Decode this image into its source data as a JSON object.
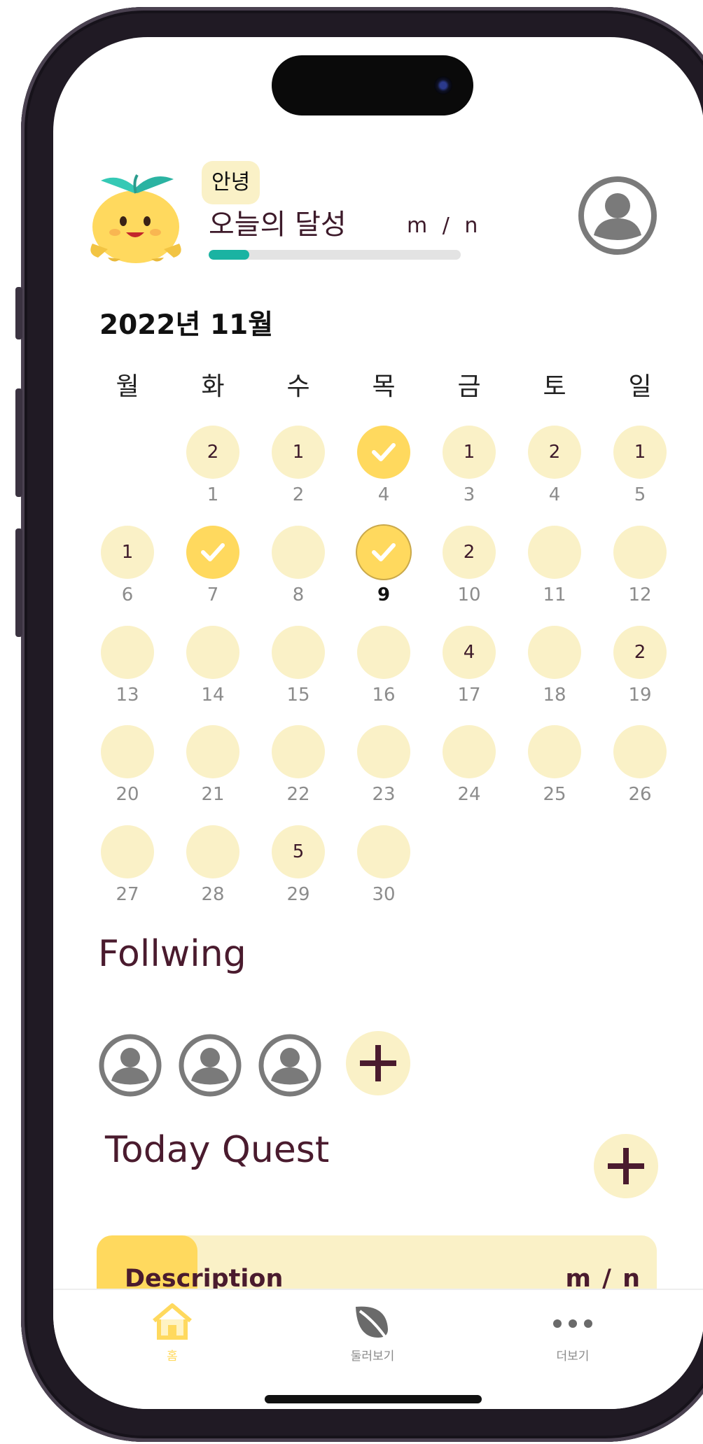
{
  "header": {
    "greeting": "안녕",
    "achievement_label": "오늘의 달성",
    "achievement_ratio": "m / n",
    "achievement_progress": 0.16
  },
  "calendar": {
    "month_title": "2022년 11월",
    "weekdays": [
      "월",
      "화",
      "수",
      "목",
      "금",
      "토",
      "일"
    ],
    "today": "9",
    "weeks": [
      [
        null,
        {
          "day": "1",
          "count": "2"
        },
        {
          "day": "2",
          "count": "1"
        },
        {
          "day": "4",
          "done": true
        },
        {
          "day": "3",
          "count": "1"
        },
        {
          "day": "4",
          "count": "2"
        },
        {
          "day": "5",
          "count": "1"
        }
      ],
      [
        {
          "day": "6",
          "count": "1"
        },
        {
          "day": "7",
          "done": true
        },
        {
          "day": "8"
        },
        {
          "day": "9",
          "done": true,
          "today": true
        },
        {
          "day": "10",
          "count": "2"
        },
        {
          "day": "11"
        },
        {
          "day": "12"
        }
      ],
      [
        {
          "day": "13"
        },
        {
          "day": "14"
        },
        {
          "day": "15"
        },
        {
          "day": "16"
        },
        {
          "day": "17",
          "count": "4"
        },
        {
          "day": "18"
        },
        {
          "day": "19",
          "count": "2"
        }
      ],
      [
        {
          "day": "20"
        },
        {
          "day": "21"
        },
        {
          "day": "22"
        },
        {
          "day": "23"
        },
        {
          "day": "24"
        },
        {
          "day": "25"
        },
        {
          "day": "26"
        }
      ],
      [
        {
          "day": "27"
        },
        {
          "day": "28"
        },
        {
          "day": "29",
          "count": "5"
        },
        {
          "day": "30"
        },
        null,
        null,
        null
      ]
    ]
  },
  "following": {
    "title": "Follwing",
    "avatar_count": 3,
    "add_icon": "plus-icon"
  },
  "quest": {
    "title": "Today Quest",
    "description": "Description",
    "ratio": "m / n",
    "progress": 0.18
  },
  "tabbar": {
    "items": [
      {
        "label": "홈",
        "icon": "home-icon",
        "active": true
      },
      {
        "label": "둘러보기",
        "icon": "leaf-icon",
        "active": false
      },
      {
        "label": "더보기",
        "icon": "more-icon",
        "active": false
      }
    ]
  },
  "colors": {
    "accent_yellow": "#ffd95e",
    "soft_yellow": "#faf1c7",
    "teal": "#1ab3a2",
    "maroon": "#4a1b2e"
  }
}
